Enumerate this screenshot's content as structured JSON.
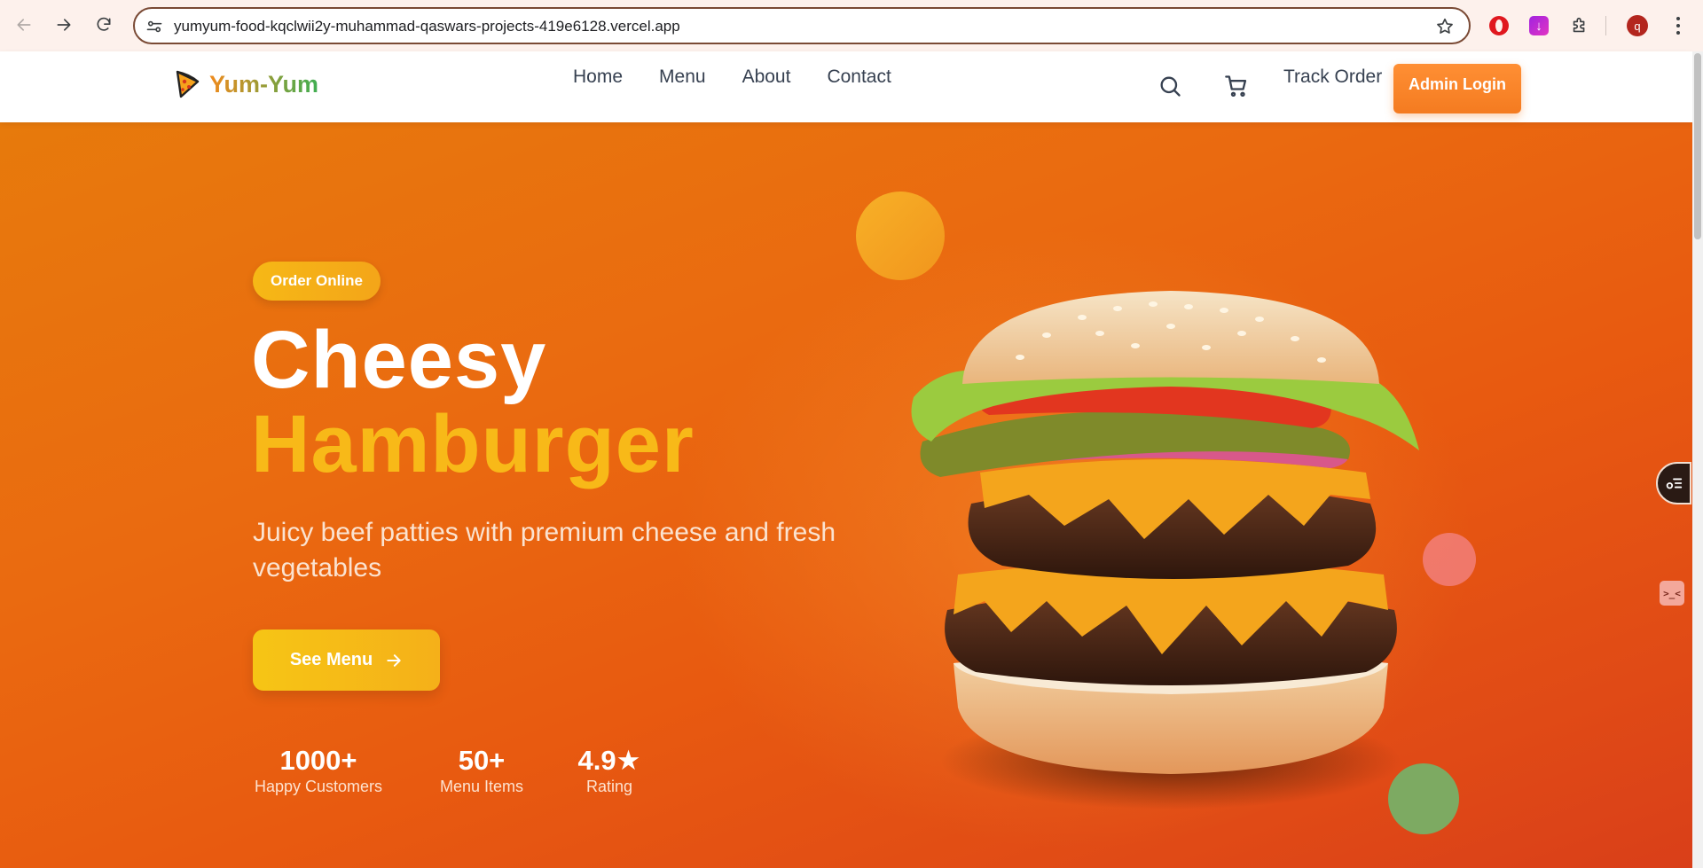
{
  "browser": {
    "url": "yumyum-food-kqclwii2y-muhammad-qaswars-projects-419e6128.vercel.app",
    "profile_initial": "q",
    "download_ext_glyph": "↓"
  },
  "header": {
    "logo_text": "Yum-Yum",
    "nav": [
      "Home",
      "Menu",
      "About",
      "Contact"
    ],
    "track_order": "Track Order",
    "admin_login": "Admin Login"
  },
  "hero": {
    "badge": "Order Online",
    "title_line1": "Cheesy",
    "title_line2": "Hamburger",
    "subtitle": "Juicy beef patties with premium cheese and fresh vegetables",
    "cta": "See Menu",
    "stats": [
      {
        "value": "1000+",
        "label": "Happy Customers"
      },
      {
        "value": "50+",
        "label": "Menu Items"
      },
      {
        "value": "4.9★",
        "label": "Rating"
      }
    ]
  },
  "side_mini_glyph": ">_<",
  "colors": {
    "brand_orange": "#f47b20",
    "accent_yellow": "#f8b918",
    "logo_green": "#3fae52"
  },
  "icons": [
    "back-arrow-icon",
    "forward-arrow-icon",
    "reload-icon",
    "site-info-icon",
    "bookmark-star-icon",
    "opera-extension-icon",
    "download-extension-icon",
    "extensions-puzzle-icon",
    "kebab-menu-icon",
    "pizza-logo-icon",
    "search-icon",
    "cart-icon",
    "arrow-right-icon",
    "floating-widget-icon"
  ]
}
